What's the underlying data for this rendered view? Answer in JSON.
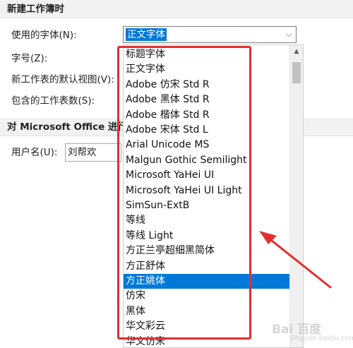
{
  "section_new_workbook": {
    "title": "新建工作簿时"
  },
  "font_setting": {
    "label": "使用的字体(N):",
    "value": "正文字体"
  },
  "size_label": "字号(Z):",
  "view_label": "新工作表的默认视图(V):",
  "sheets_label": "包含的工作表数(S):",
  "section_personalize": {
    "title": "对 Microsoft Office 进行"
  },
  "username": {
    "label": "用户名(U):",
    "value": "刘帮欢"
  },
  "font_list": [
    "标题字体",
    "正文字体",
    "Adobe 仿宋 Std R",
    "Adobe 黑体 Std R",
    "Adobe 楷体 Std R",
    "Adobe 宋体 Std L",
    "Arial Unicode MS",
    "Malgun Gothic Semilight",
    "Microsoft YaHei UI",
    "Microsoft YaHei UI Light",
    "SimSun-ExtB",
    "等线",
    "等线 Light",
    "方正兰亭超细黑简体",
    "方正舒体",
    "方正姚体",
    "仿宋",
    "黑体",
    "华文彩云",
    "华文仿宋"
  ],
  "selected_font": "方正姚体",
  "watermark": {
    "main": "Bai 百度",
    "sub": "jingyan.baidu.com"
  },
  "colors": {
    "highlight": "#e03030",
    "selection": "#0078d7"
  }
}
